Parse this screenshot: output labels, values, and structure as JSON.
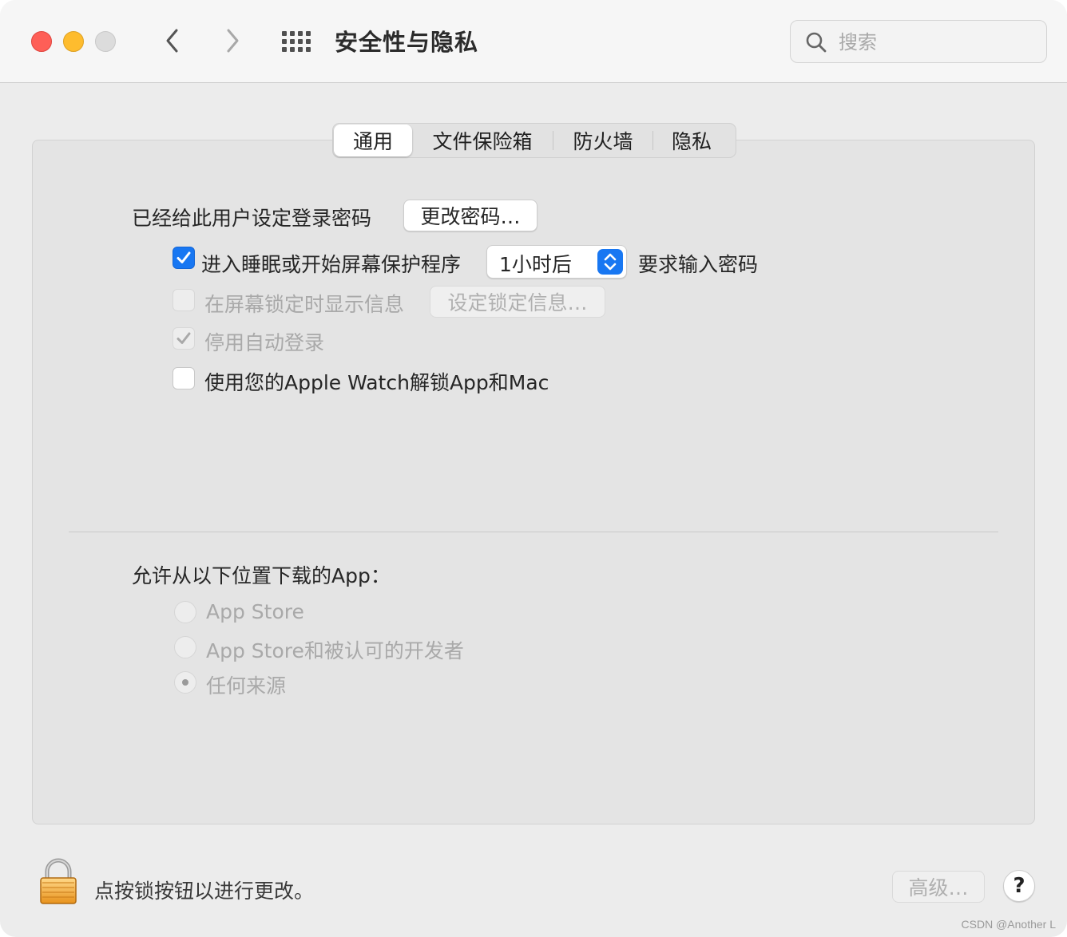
{
  "window": {
    "title": "安全性与隐私",
    "search_placeholder": "搜索"
  },
  "tabs": [
    {
      "label": "通用",
      "active": true
    },
    {
      "label": "文件保险箱",
      "active": false
    },
    {
      "label": "防火墙",
      "active": false
    },
    {
      "label": "隐私",
      "active": false
    }
  ],
  "general": {
    "password_set_label": "已经给此用户设定登录密码",
    "change_password_button": "更改密码…",
    "require_password": {
      "checked": true,
      "label_before": "进入睡眠或开始屏幕保护程序",
      "delay_value": "1小时后",
      "label_after": "要求输入密码"
    },
    "lock_message": {
      "checked": false,
      "enabled": false,
      "label": "在屏幕锁定时显示信息",
      "button": "设定锁定信息…"
    },
    "disable_auto_login": {
      "checked": true,
      "enabled": false,
      "label": "停用自动登录"
    },
    "apple_watch": {
      "checked": false,
      "label": "使用您的Apple Watch解锁App和Mac"
    }
  },
  "downloads": {
    "heading": "允许从以下位置下载的App：",
    "options": [
      {
        "label": "App Store",
        "selected": false
      },
      {
        "label": "App Store和被认可的开发者",
        "selected": false
      },
      {
        "label": "任何来源",
        "selected": true
      }
    ]
  },
  "footer": {
    "lock_text": "点按锁按钮以进行更改。",
    "advanced_button": "高级…",
    "help_button": "?"
  },
  "watermark": "CSDN @Another L",
  "colors": {
    "accent": "#1877f2",
    "close": "#fe5f57",
    "minimize": "#febc2e"
  }
}
